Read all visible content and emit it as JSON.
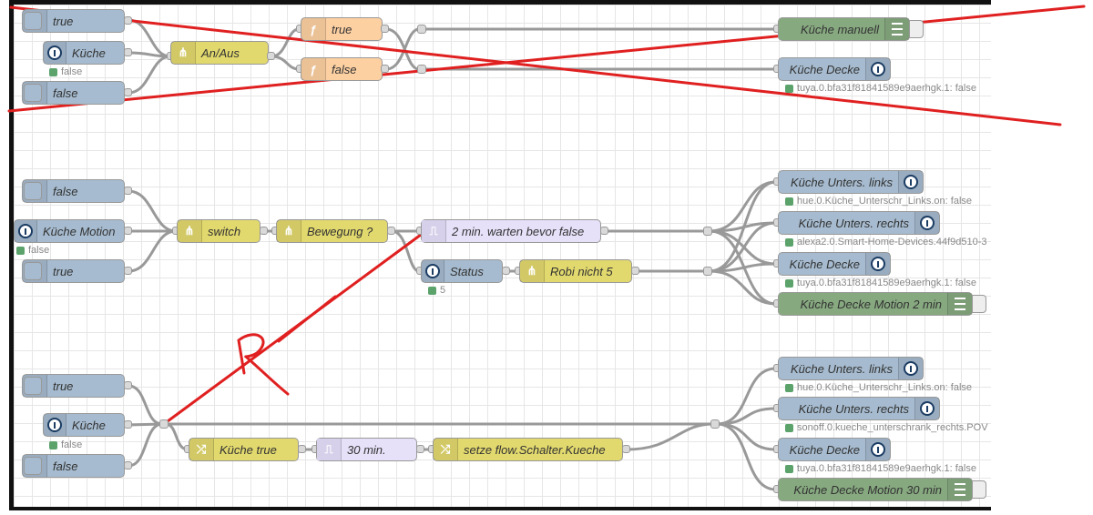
{
  "flow1": {
    "inject_true": "true",
    "kueche_in": "Küche",
    "kueche_in_status": "false",
    "inject_false": "false",
    "switch": "An/Aus",
    "func_true": "true",
    "func_false": "false",
    "out_manuell": "Küche manuell",
    "out_decke": "Küche Decke",
    "out_decke_status": "tuya.0.bfa31f81841589e9aerhgk.1: false"
  },
  "flow2": {
    "inject_false": "false",
    "motion": "Küche Motion",
    "motion_status": "false",
    "inject_true": "true",
    "switch": "switch",
    "bewegung": "Bewegung ?",
    "trigger": "2 min. warten bevor false",
    "status_node": "Status",
    "status_node_status": "5",
    "robi": "Robi nicht 5",
    "out1": "Küche Unters. links",
    "out1_status": "hue.0.Küche_Unterschr_Links.on: false",
    "out2": "Küche Unters. rechts",
    "out2_status": "alexa2.0.Smart-Home-Devices.44f9d510-3",
    "out3": "Küche Decke",
    "out3_status": "tuya.0.bfa31f81841589e9aerhgk.1: false",
    "out4": "Küche Decke Motion 2 min"
  },
  "flow3": {
    "inject_true": "true",
    "kueche_in": "Küche",
    "kueche_in_status": "false",
    "inject_false": "false",
    "change_kueche": "Küche true",
    "trigger": "30 min.",
    "change_flow": "setze flow.Schalter.Kueche",
    "out1": "Küche Unters. links",
    "out1_status": "hue.0.Küche_Unterschr_Links.on: false",
    "out2": "Küche Unters. rechts",
    "out2_status": "sonoff.0.kueche_unterschrank_rechts.POV",
    "out3": "Küche Decke",
    "out3_status": "tuya.0.bfa31f81841589e9aerhgk.1: false",
    "out4": "Küche Decke Motion 30 min"
  },
  "colors": {
    "inject": "#a6bbcf",
    "switch": "#e2d96e",
    "function": "#fdd0a2",
    "debug": "#87a980",
    "trigger": "#e6e0f8",
    "annotation": "#e02020"
  },
  "annotation_text": "R"
}
